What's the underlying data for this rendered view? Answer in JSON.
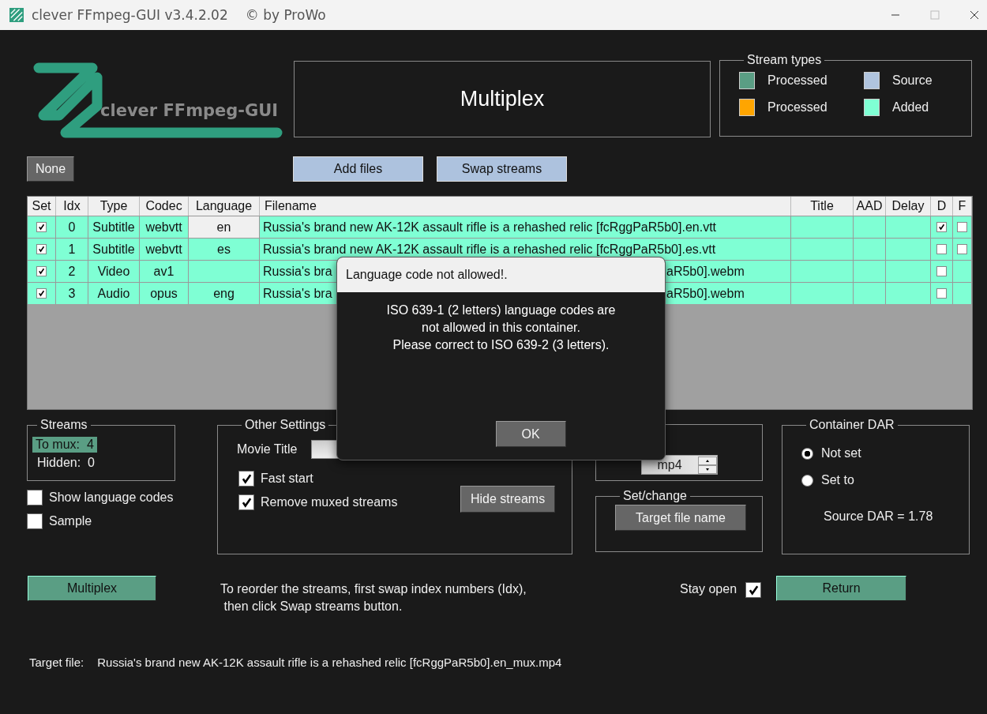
{
  "window": {
    "title": "clever FFmpeg-GUI v3.4.2.02",
    "credit": "© by ProWo"
  },
  "logo": {
    "text": "clever FFmpeg-GUI"
  },
  "header": {
    "title": "Multiplex"
  },
  "stream_types": {
    "title": "Stream types",
    "items": [
      {
        "label": "Processed",
        "color": "#5a9e84"
      },
      {
        "label": "Source",
        "color": "#b0c4de"
      },
      {
        "label": "Processed",
        "color": "#ffa500"
      },
      {
        "label": "Added",
        "color": "#7fffd4"
      }
    ]
  },
  "toolbar": {
    "none_button": "None",
    "add_files_button": "Add files",
    "swap_streams_button": "Swap streams"
  },
  "table": {
    "columns": [
      "Set",
      "Idx",
      "Type",
      "Codec",
      "Language",
      "Filename",
      "Title",
      "AAD",
      "Delay",
      "D",
      "F"
    ],
    "rows": [
      {
        "set": true,
        "idx": "0",
        "type": "Subtitle",
        "codec": "webvtt",
        "language": "en",
        "language_selected": true,
        "filename": [
          "Russia's brand new AK-12K assault rifle is a rehashed relic [fcRggPaR5b0].en.vtt"
        ],
        "d": true,
        "f": false,
        "color": "#7fffd4"
      },
      {
        "set": true,
        "idx": "1",
        "type": "Subtitle",
        "codec": "webvtt",
        "language": "es",
        "language_selected": false,
        "filename": [
          "Russia's brand new AK-12K assault rifle is a rehashed relic [fcRggPaR5b0].es.vtt"
        ],
        "d": false,
        "f": false,
        "color": "#7fffd4"
      },
      {
        "set": true,
        "idx": "2",
        "type": "Video",
        "codec": "av1",
        "language_selected": false,
        "filename": [
          "Russia's bra",
          "aR5b0].webm"
        ],
        "d": false,
        "color": "#7fffd4"
      },
      {
        "set": true,
        "idx": "3",
        "type": "Audio",
        "codec": "opus",
        "language": "eng",
        "language_selected": false,
        "filename": [
          "Russia's bra",
          "aR5b0].webm"
        ],
        "d": false,
        "color": "#7fffd4"
      }
    ]
  },
  "streams": {
    "title": "Streams",
    "to_mux": "To mux:  4",
    "hidden": "Hidden:  0"
  },
  "options": [
    {
      "label": "Show language codes",
      "checked": false
    },
    {
      "label": "Sample",
      "checked": false
    }
  ],
  "other_settings": {
    "title": "Other Settings",
    "movie_title_label": "Movie Title",
    "checks": [
      {
        "label": "Fast start",
        "checked": true
      },
      {
        "label": "Remove muxed streams",
        "checked": true
      }
    ],
    "hide_streams_button": "Hide streams"
  },
  "container": {
    "format": "mp4"
  },
  "set_change": {
    "title": "Set/change",
    "button": "Target file name"
  },
  "container_dar": {
    "title": "Container DAR",
    "options": [
      {
        "label": "Not set",
        "selected": true
      },
      {
        "label": "Set to",
        "selected": false
      }
    ],
    "source_dar": "Source DAR = 1.78"
  },
  "multiplex_button": "Multiplex",
  "hint": "To reorder the streams, first swap index numbers (Idx),\n then click Swap streams button.",
  "stay_open": {
    "label": "Stay open",
    "checked": true
  },
  "return_button": "Return",
  "target_file": {
    "label": "Target file:",
    "value": "Russia's brand new AK-12K assault rifle is a rehashed relic [fcRggPaR5b0].en_mux.mp4"
  },
  "dialog": {
    "title": "Language code not allowed!.",
    "message": "ISO 639-1 (2 letters) language codes are\nnot allowed in this container.\nPlease correct to ISO 639-2 (3 letters).",
    "ok_button": "OK"
  }
}
